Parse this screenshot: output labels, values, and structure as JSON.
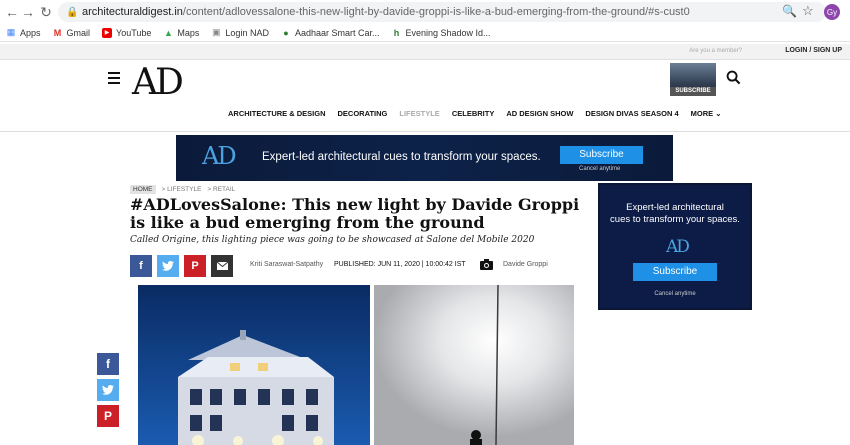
{
  "browser": {
    "url_host": "architecturaldigest.in",
    "url_rest": "/content/adlovessalone-this-new-light-by-davide-groppi-is-like-a-bud-emerging-from-the-ground/#s-cust0",
    "profile_initials": "Gy"
  },
  "bookmarks": [
    {
      "label": "Apps"
    },
    {
      "label": "Gmail"
    },
    {
      "label": "YouTube"
    },
    {
      "label": "Maps"
    },
    {
      "label": "Login NAD"
    },
    {
      "label": "Aadhaar Smart Car..."
    },
    {
      "label": "Evening Shadow Id..."
    }
  ],
  "site_top": {
    "member_text": "Are you a member?",
    "login_text": "LOGIN / SIGN UP"
  },
  "header": {
    "logo": "AD",
    "subscribe_label": "SUBSCRIBE"
  },
  "nav": [
    {
      "label": "ARCHITECTURE & DESIGN"
    },
    {
      "label": "DECORATING"
    },
    {
      "label": "LIFESTYLE"
    },
    {
      "label": "CELEBRITY"
    },
    {
      "label": "AD DESIGN SHOW"
    },
    {
      "label": "DESIGN DIVAS SEASON 4"
    },
    {
      "label": "MORE"
    }
  ],
  "ad_banner": {
    "logo": "AD",
    "text": "Expert-led architectural cues to transform your spaces.",
    "button": "Subscribe",
    "cancel": "Cancel anytime"
  },
  "breadcrumb": {
    "home": "HOME",
    "items": [
      "> LIFESTYLE",
      "> RETAIL"
    ]
  },
  "article": {
    "title": "#ADLovesSalone: This new light by Davide Groppi is like a bud emerging from the ground",
    "subtitle": "Called Origine, this lighting piece was going to be showcased at Salone del Mobile 2020",
    "author": "Kriti Saraswat-Satpathy",
    "published": "PUBLISHED: JUN 11, 2020 | 10:00:42 IST",
    "photographer": "Davide Groppi"
  },
  "side_ad": {
    "text_line1": "Expert-led architectural",
    "text_line2": "cues to transform your spaces.",
    "logo": "AD",
    "button": "Subscribe",
    "cancel": "Cancel anytime"
  },
  "colors": {
    "facebook": "#3b5998",
    "twitter": "#55acee",
    "pinterest": "#cb2027",
    "ad_blue": "#1e90e6"
  }
}
